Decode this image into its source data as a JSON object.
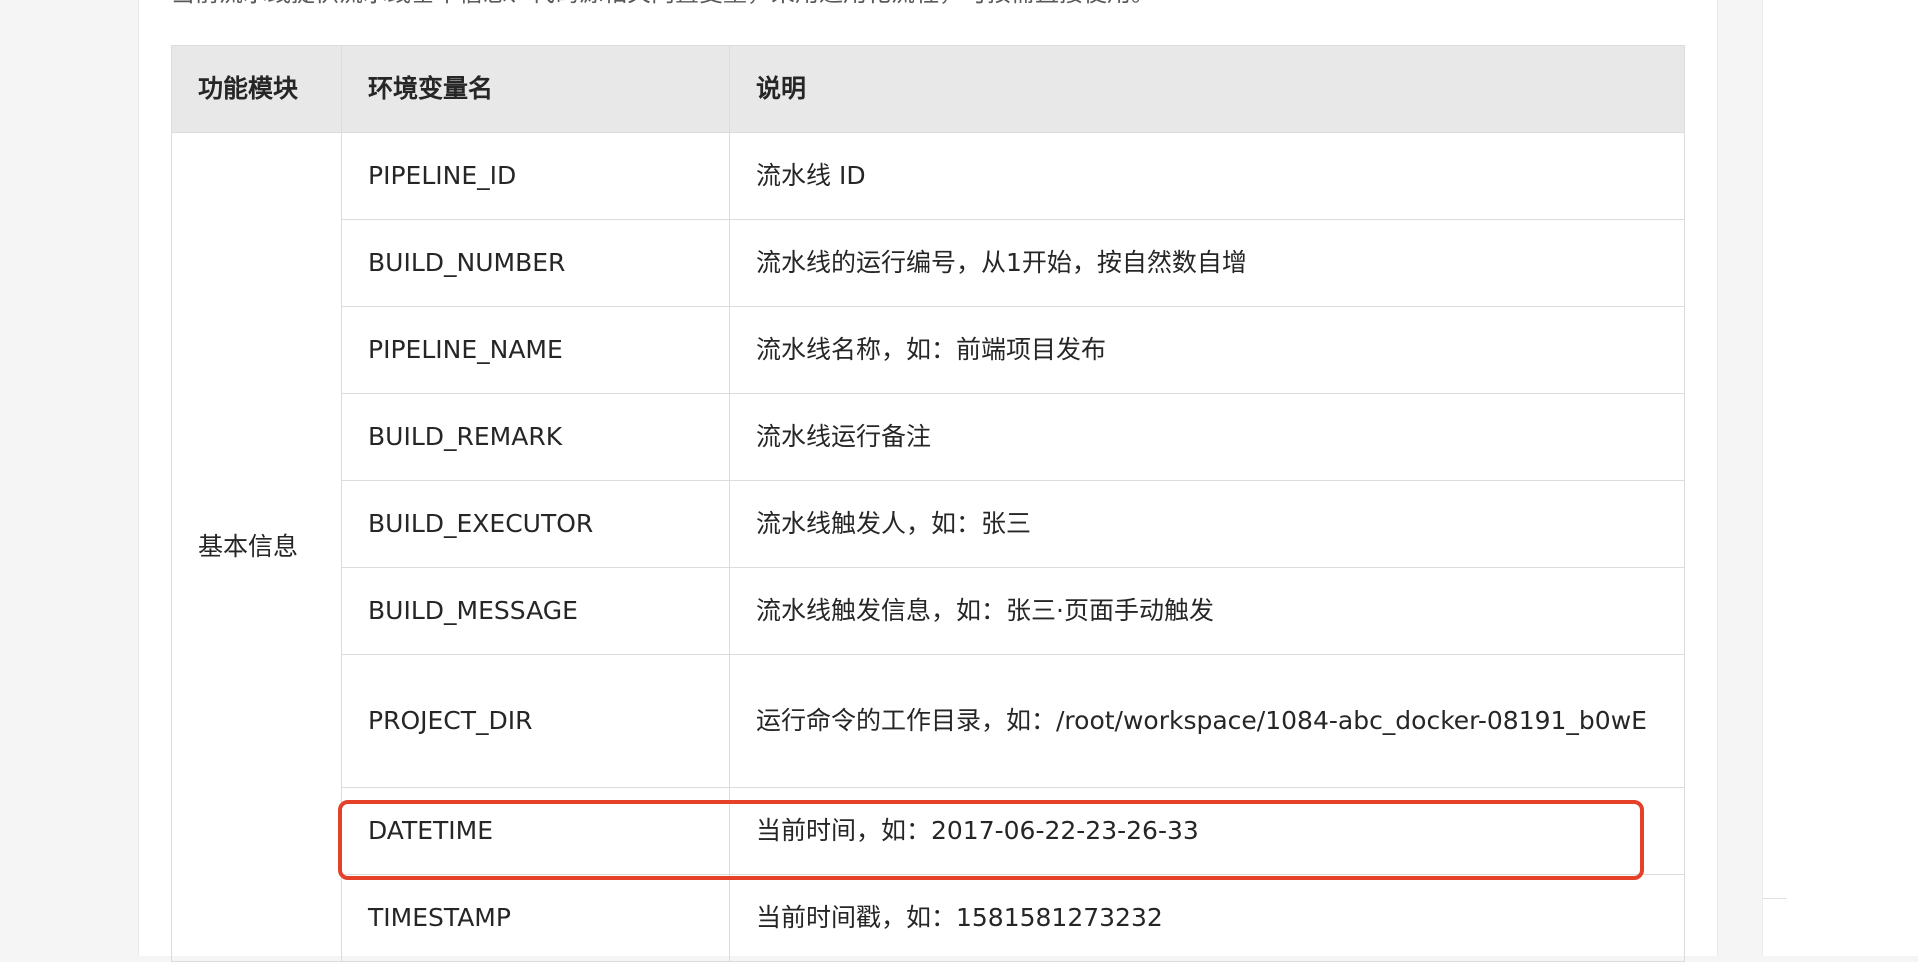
{
  "intro_text": "当前流水线提供流水线基本信息、代码源相关内置变量，采用通用化流程，可按需直接使用。",
  "table": {
    "headers": [
      "功能模块",
      "环境变量名",
      "说明"
    ],
    "module": "基本信息",
    "rows": [
      {
        "var": "PIPELINE_ID",
        "desc": "流水线 ID"
      },
      {
        "var": "BUILD_NUMBER",
        "desc": "流水线的运行编号，从1开始，按自然数自增"
      },
      {
        "var": "PIPELINE_NAME",
        "desc": "流水线名称，如：前端项目发布"
      },
      {
        "var": "BUILD_REMARK",
        "desc": "流水线运行备注"
      },
      {
        "var": "BUILD_EXECUTOR",
        "desc": "流水线触发人，如：张三"
      },
      {
        "var": "BUILD_MESSAGE",
        "desc": "流水线触发信息，如：张三·页面手动触发"
      },
      {
        "var": "PROJECT_DIR",
        "desc": "运行命令的工作目录，如：/root/workspace/1084-abc_docker-08191_b0wE"
      },
      {
        "var": "DATETIME",
        "desc": "当前时间，如：2017-06-22-23-26-33"
      },
      {
        "var": "TIMESTAMP",
        "desc": "当前时间戳，如：1581581273232"
      }
    ]
  },
  "highlight": {
    "row_var": "DATETIME",
    "color": "#e5402a"
  }
}
